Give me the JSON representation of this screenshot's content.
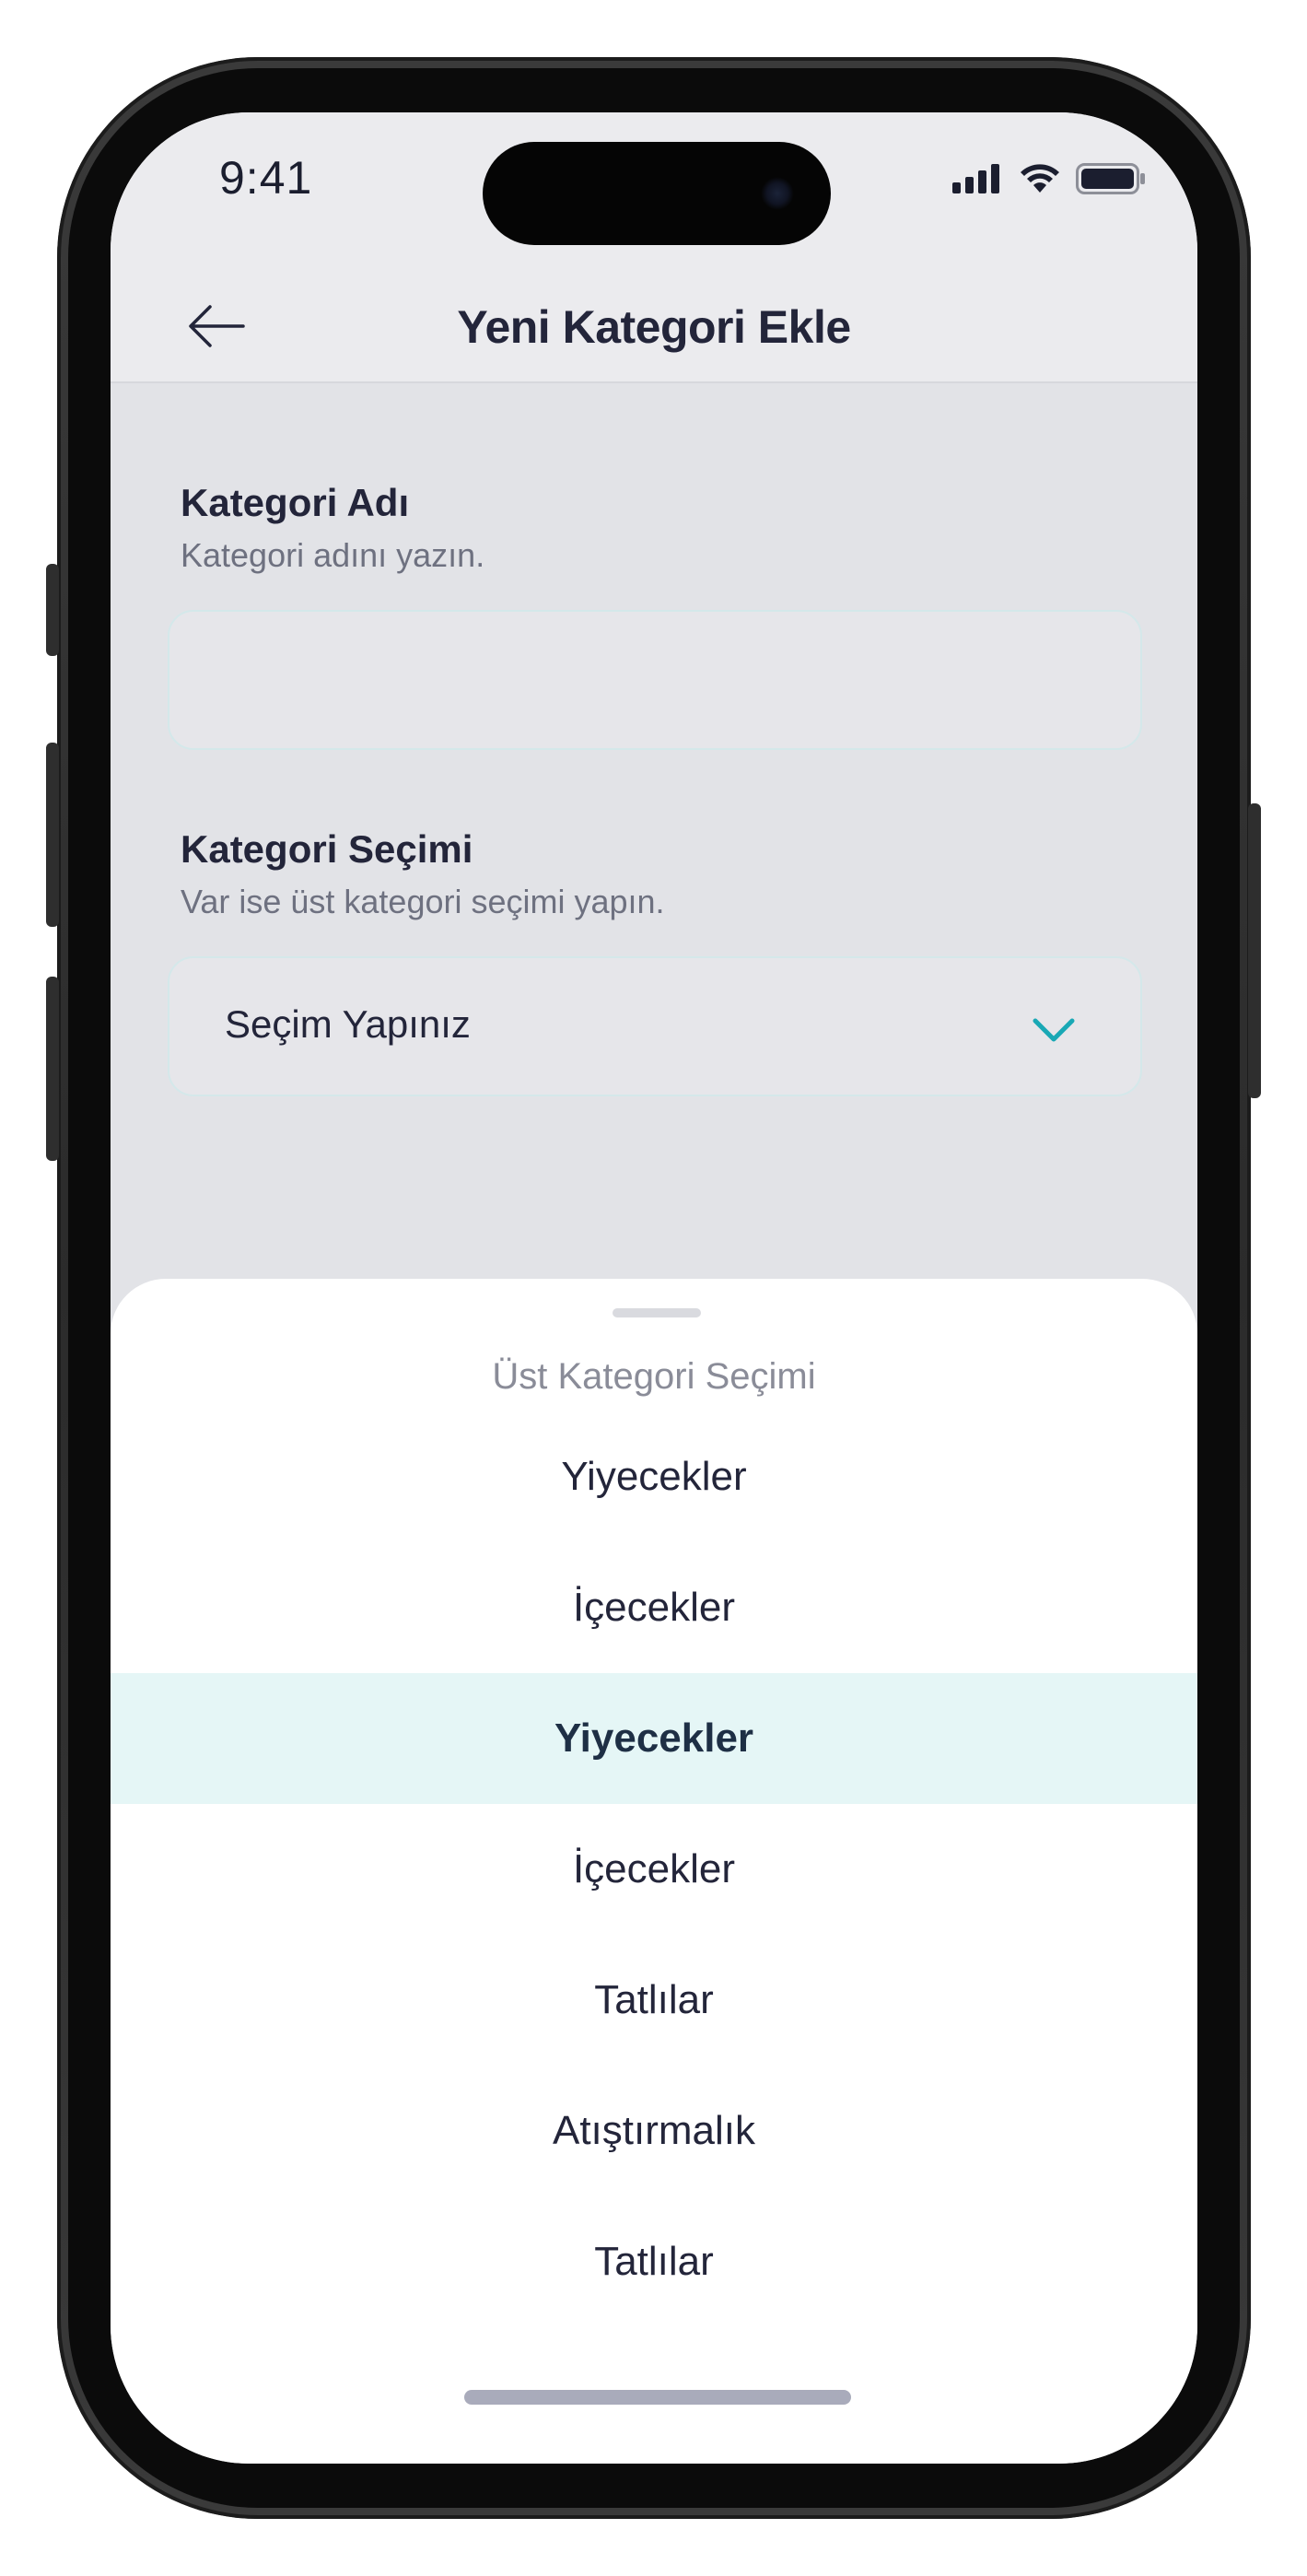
{
  "status_bar": {
    "time": "9:41"
  },
  "nav": {
    "title": "Yeni Kategori Ekle",
    "back_icon": "arrow-left-icon"
  },
  "form": {
    "category_name": {
      "label": "Kategori Adı",
      "hint": "Kategori adını yazın.",
      "value": ""
    },
    "category_select": {
      "label": "Kategori Seçimi",
      "hint": "Var ise üst kategori seçimi yapın.",
      "value": "Seçim Yapınız",
      "icon": "chevron-down-icon"
    }
  },
  "sheet": {
    "title": "Üst Kategori Seçimi",
    "options": [
      {
        "label": "Yiyecekler",
        "selected": false
      },
      {
        "label": "İçecekler",
        "selected": false
      },
      {
        "label": "Yiyecekler",
        "selected": true
      },
      {
        "label": "İçecekler",
        "selected": false
      },
      {
        "label": "Tatlılar",
        "selected": false
      },
      {
        "label": "Atıştırmalık",
        "selected": false
      },
      {
        "label": "Tatlılar",
        "selected": false
      }
    ]
  },
  "colors": {
    "accent": "#19a8b5",
    "selected_row": "#e5f6f6",
    "text_primary": "#23253a",
    "text_secondary": "#6e7180",
    "screen_background": "#e2e3e7"
  }
}
